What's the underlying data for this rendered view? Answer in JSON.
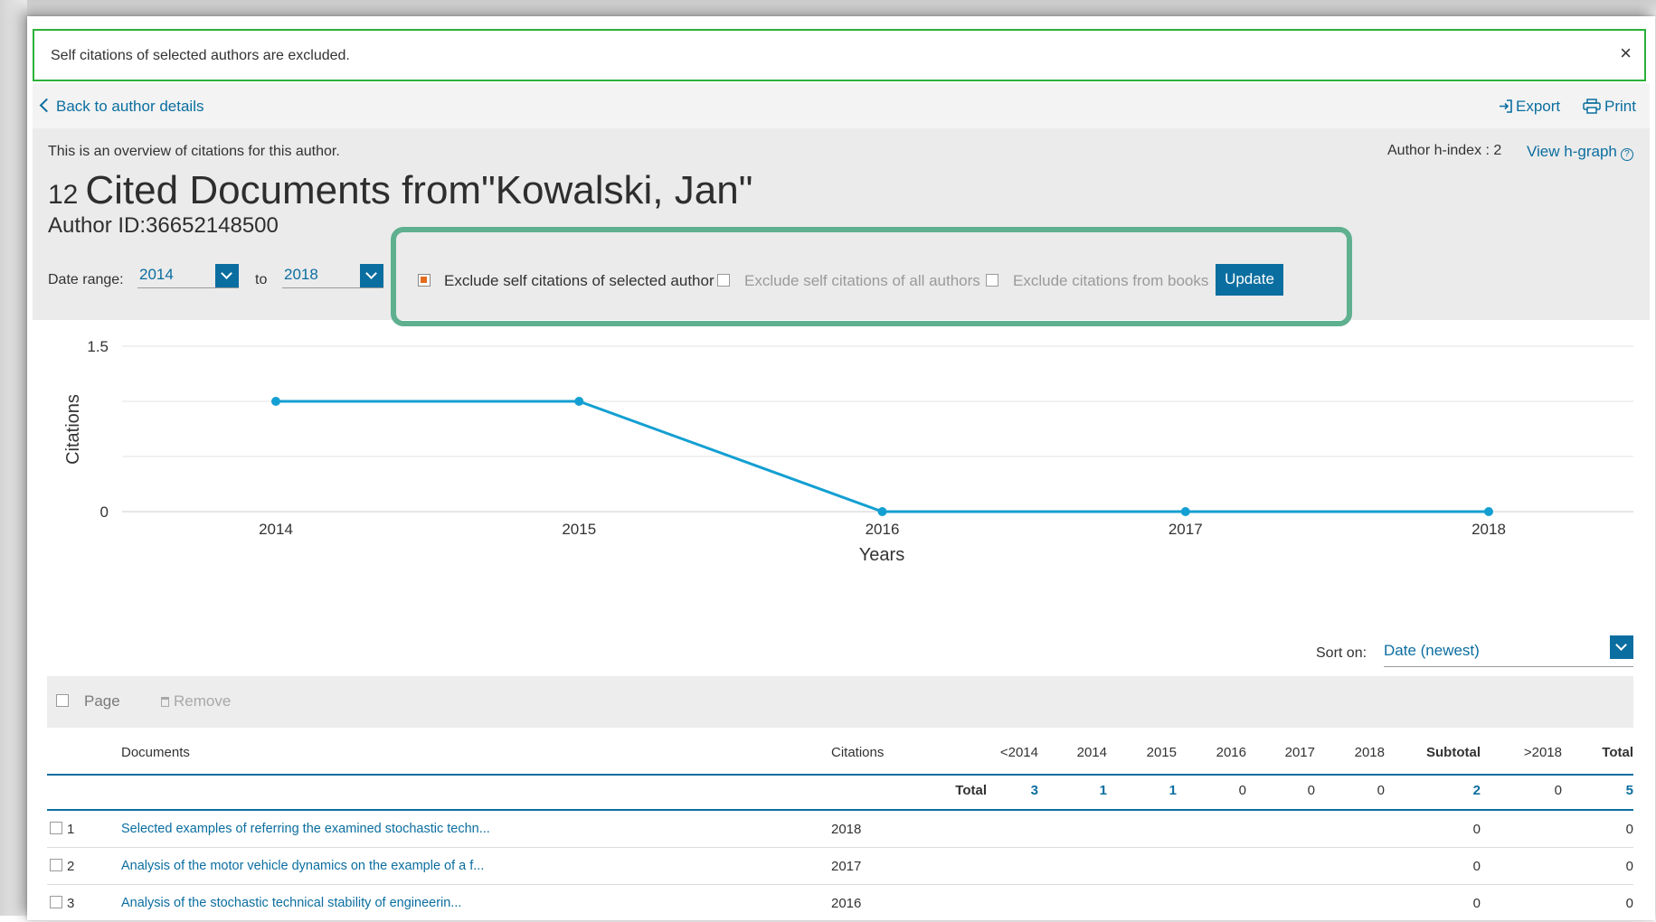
{
  "notice": {
    "text": "Self citations of selected authors are excluded.",
    "close": "×"
  },
  "nav": {
    "back": "Back to author details",
    "export": "Export",
    "print": "Print"
  },
  "header": {
    "overview": "This is an overview of citations for this author.",
    "count": "12",
    "title": "Cited Documents from\"Kowalski, Jan\"",
    "author_id": "Author ID:36652148500",
    "h_index_label": "Author h-index : 2",
    "h_graph_link": "View h-graph"
  },
  "date_range": {
    "label": "Date range:",
    "from": "2014",
    "to_label": "to",
    "to": "2018"
  },
  "filters": {
    "exclude_selected": {
      "label": "Exclude self citations of selected author",
      "checked": true
    },
    "exclude_all": {
      "label": "Exclude self citations of all authors",
      "checked": false
    },
    "exclude_books": {
      "label": "Exclude citations from books",
      "checked": false
    },
    "update": "Update"
  },
  "chart_data": {
    "type": "line",
    "x": [
      "2014",
      "2015",
      "2016",
      "2017",
      "2018"
    ],
    "series": [
      {
        "values": [
          1,
          1,
          0,
          0,
          0
        ]
      }
    ],
    "xlabel": "Years",
    "ylabel": "Citations",
    "ylim": [
      0,
      1.5
    ],
    "yticks": [
      "0",
      "1.5"
    ],
    "grid": true,
    "color": "#139fd2"
  },
  "sort": {
    "label": "Sort on:",
    "value": "Date (newest)"
  },
  "toolbar": {
    "page": "Page",
    "remove": "Remove"
  },
  "table": {
    "headers": {
      "documents": "Documents",
      "citations": "Citations",
      "lt2014": "<2014",
      "y2014": "2014",
      "y2015": "2015",
      "y2016": "2016",
      "y2017": "2017",
      "y2018": "2018",
      "subtotal": "Subtotal",
      "gt2018": ">2018",
      "total": "Total"
    },
    "totals": {
      "label": "Total",
      "lt2014": "3",
      "y2014": "1",
      "y2015": "1",
      "y2016": "0",
      "y2017": "0",
      "y2018": "0",
      "subtotal": "2",
      "gt2018": "0",
      "total": "5"
    },
    "rows": [
      {
        "num": "1",
        "title": "Selected examples of referring the examined stochastic techn...",
        "year": "2018",
        "subtotal": "0",
        "total": "0"
      },
      {
        "num": "2",
        "title": "Analysis of the motor vehicle dynamics on the example of a f...",
        "year": "2017",
        "subtotal": "0",
        "total": "0"
      },
      {
        "num": "3",
        "title": "Analysis of the stochastic technical stability of engineerin...",
        "year": "2016",
        "subtotal": "0",
        "total": "0"
      }
    ]
  }
}
